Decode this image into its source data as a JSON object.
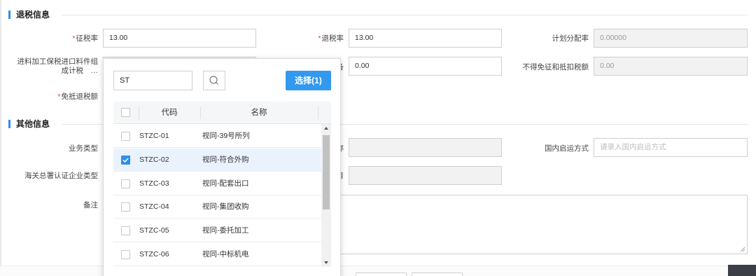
{
  "sections": {
    "tax_refund": "退税信息",
    "other": "其他信息"
  },
  "tax_refund": {
    "levy_rate_label": "征税率",
    "levy_rate_value": "13.00",
    "refund_rate_label": "退税率",
    "refund_rate_value": "13.00",
    "plan_alloc_label": "计划分配率",
    "plan_alloc_value": "0.00000",
    "bonded_import_label_1": "进料加工保税进口料件组",
    "bonded_import_label_2": "成计税　…",
    "partial_label_suffix": "备",
    "partial_value": "0.00",
    "non_exempt_label": "不得免征和抵扣税额",
    "non_exempt_value": "0.00",
    "exempt_offset_label": "免抵退税额"
  },
  "other": {
    "business_type_label": "业务类型",
    "partial_name_label": "称",
    "domestic_transport_label": "国内启运方式",
    "domestic_transport_placeholder": "请录入国内启运方式",
    "customs_cert_label": "海关总署认证企业类型",
    "partial_month_label": "目",
    "remark_label": "备注"
  },
  "dropdown": {
    "search_value": "ST",
    "select_button": "选择(1)",
    "col_code": "代码",
    "col_name": "名称",
    "rows": [
      {
        "code": "STZC-01",
        "name": "视同-39号所列",
        "checked": false
      },
      {
        "code": "STZC-02",
        "name": "视同-符合外购",
        "checked": true
      },
      {
        "code": "STZC-03",
        "name": "视同-配套出口",
        "checked": false
      },
      {
        "code": "STZC-04",
        "name": "视同-集团收购",
        "checked": false
      },
      {
        "code": "STZC-05",
        "name": "视同-委托加工",
        "checked": false
      },
      {
        "code": "STZC-06",
        "name": "视同-中标机电",
        "checked": false
      }
    ]
  },
  "colors": {
    "accent": "#2f8ee9",
    "select_button": "#3399ee",
    "required": "#e04040",
    "checked_row": "#eaf3fd"
  }
}
